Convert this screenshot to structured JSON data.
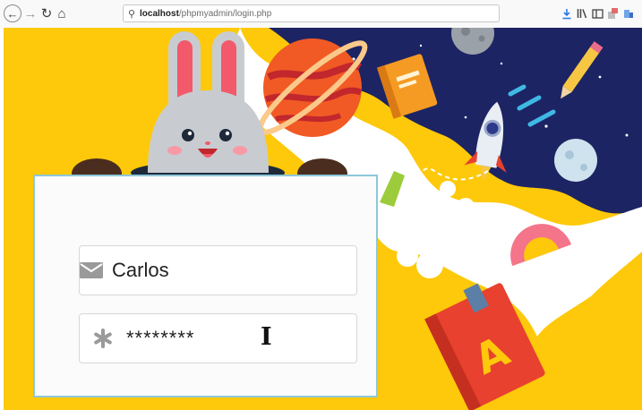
{
  "browser": {
    "url_host": "localhost",
    "url_path": "/phpmyadmin/login.php",
    "nav_icons": [
      "back-arrow-icon",
      "forward-arrow-icon",
      "reload-icon",
      "home-icon"
    ],
    "right_icons": [
      "download-icon",
      "library-icon",
      "sidebar-icon",
      "extension-icon",
      "account-icon"
    ]
  },
  "login": {
    "username_value": "Carlos",
    "password_value": "********",
    "username_icon": "envelope-icon",
    "password_icon": "asterisk-icon",
    "cursor_icon": "text-cursor-icon"
  },
  "illustration": {
    "book_letter": "A"
  },
  "colors": {
    "background_yellow": "#fdc90a",
    "space_navy": "#1d2463",
    "card_border": "#8fc7d9",
    "bunny_ear": "#f25a6b",
    "book_red": "#e8412f"
  }
}
